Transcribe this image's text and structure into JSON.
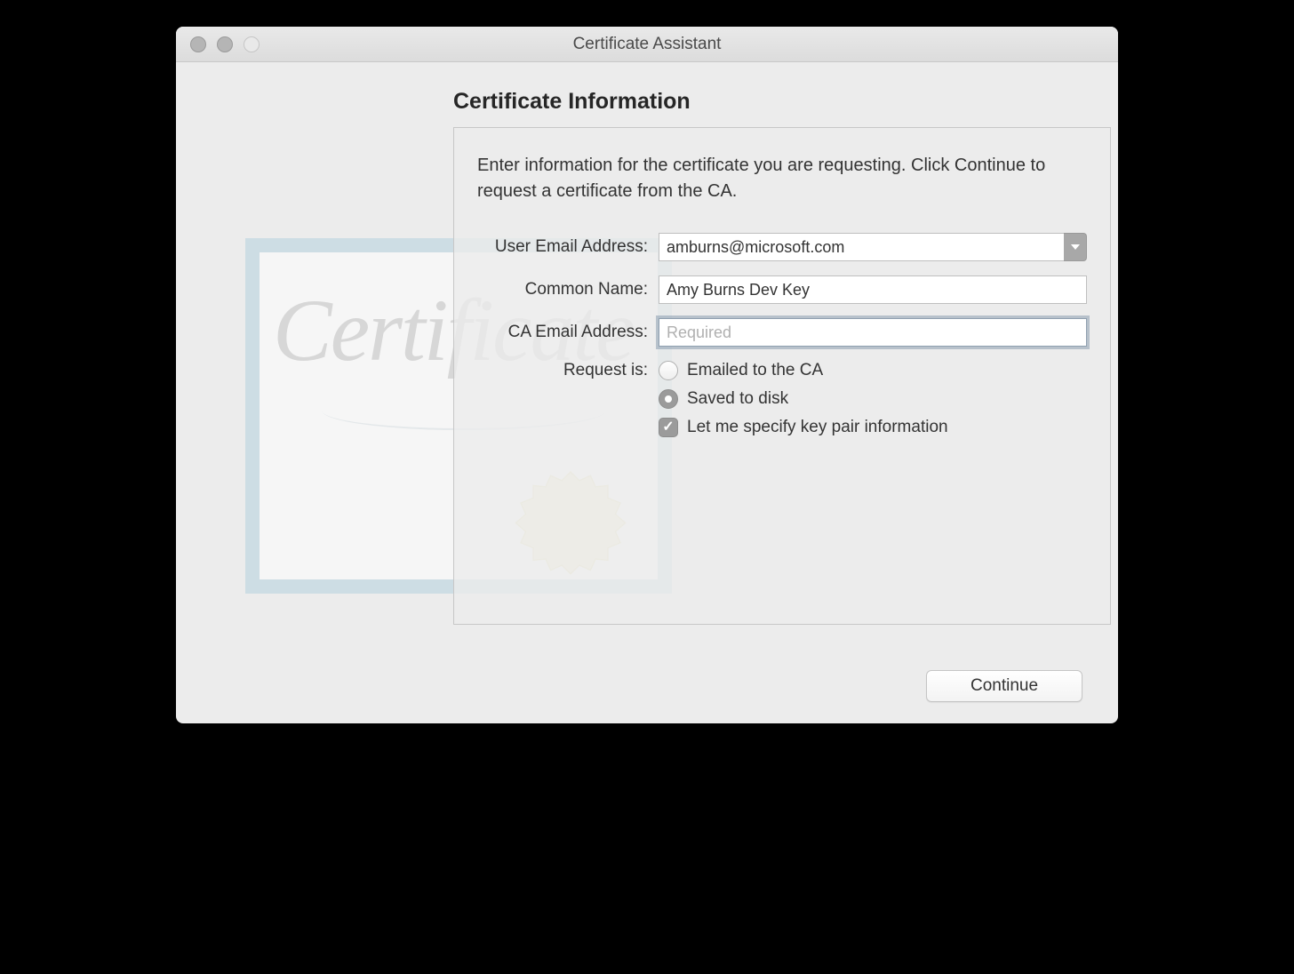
{
  "window": {
    "title": "Certificate Assistant"
  },
  "heading": "Certificate Information",
  "instructions": "Enter information for the certificate you are requesting. Click Continue to request a certificate from the CA.",
  "form": {
    "user_email_label": "User Email Address:",
    "user_email_value": "amburns@microsoft.com",
    "common_name_label": "Common Name:",
    "common_name_value": "Amy Burns Dev Key",
    "ca_email_label": "CA Email Address:",
    "ca_email_value": "",
    "ca_email_placeholder": "Required",
    "request_label": "Request is:",
    "option_emailed": "Emailed to the CA",
    "option_saved": "Saved to disk",
    "option_keypair": "Let me specify key pair information"
  },
  "buttons": {
    "continue": "Continue"
  },
  "decor": {
    "cert_word": "Certificate"
  }
}
